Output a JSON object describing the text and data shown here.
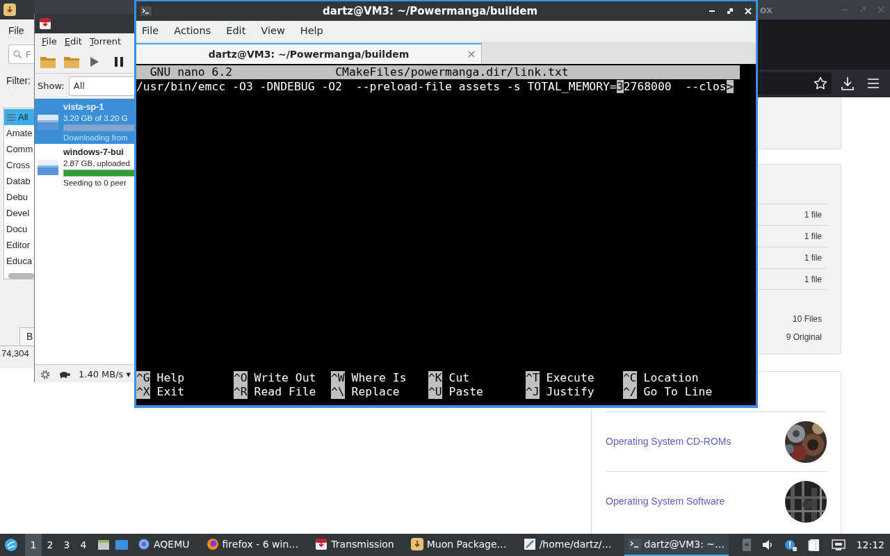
{
  "firefox": {
    "title": "ox",
    "file_counts": [
      "1 file",
      "1 file",
      "1 file",
      "1 file"
    ],
    "totals": [
      "10 Files",
      "9 Original"
    ],
    "links": [
      {
        "text": "Operating System CD-ROMs"
      },
      {
        "text": "Operating System Software"
      }
    ]
  },
  "muon": {
    "menu": [
      "File"
    ],
    "search": {
      "placeholder": "F"
    },
    "filter_label": "Filter:",
    "categories": [
      {
        "label": "All",
        "selected": true
      },
      {
        "label": "Amate",
        "selected": false
      },
      {
        "label": "Comm",
        "selected": false
      },
      {
        "label": "Cross",
        "selected": false
      },
      {
        "label": "Datab",
        "selected": false
      },
      {
        "label": "Debu",
        "selected": false
      },
      {
        "label": "Devel",
        "selected": false
      },
      {
        "label": "Docu",
        "selected": false
      },
      {
        "label": "Editor",
        "selected": false
      },
      {
        "label": "Educa",
        "selected": false
      }
    ],
    "bottom_tab": "B",
    "status": "74,304"
  },
  "transmission": {
    "menu": [
      "File",
      "Edit",
      "Torrent"
    ],
    "show_label": "Show:",
    "show_value": "All",
    "torrents": [
      {
        "name": "vista-sp-1",
        "size": "3.20 GB of 3.20 G",
        "level": 1,
        "status": "Downloading from",
        "kind": "downloading",
        "selected": true
      },
      {
        "name": "windows-7-bui",
        "size": "2.87 GB, uploaded",
        "level": 1,
        "status": "Seeding to 0 peer",
        "kind": "seeding",
        "selected": false
      }
    ],
    "speed": "1.40 MB/s ▾"
  },
  "terminal": {
    "title": "dartz@VM3: ~/Powermanga/buildem",
    "menu": [
      "File",
      "Actions",
      "Edit",
      "View",
      "Help"
    ],
    "tab": "dartz@VM3: ~/Powermanga/buildem",
    "nano": {
      "version": "GNU nano 6.2",
      "filename": "CMakeFiles/powermanga.dir/link.txt",
      "line_before_cursor": "/usr/bin/emcc -O3 -DNDEBUG -O2  --preload-file assets -s TOTAL_MEMORY=",
      "cursor_char": "3",
      "line_after_cursor": "2768000  --clos",
      "overflow_mark": ">",
      "shortcuts": [
        [
          {
            "key": "^G",
            "label": "Help"
          },
          {
            "key": "^O",
            "label": "Write Out"
          },
          {
            "key": "^W",
            "label": "Where Is"
          },
          {
            "key": "^K",
            "label": "Cut"
          },
          {
            "key": "^T",
            "label": "Execute"
          },
          {
            "key": "^C",
            "label": "Location"
          }
        ],
        [
          {
            "key": "^X",
            "label": "Exit"
          },
          {
            "key": "^R",
            "label": "Read File"
          },
          {
            "key": "^\\",
            "label": "Replace"
          },
          {
            "key": "^U",
            "label": "Paste"
          },
          {
            "key": "^J",
            "label": "Justify"
          },
          {
            "key": "^/",
            "label": "Go To Line"
          }
        ]
      ]
    }
  },
  "taskbar": {
    "workspaces": [
      {
        "label": "1",
        "selected": true
      },
      {
        "label": "2",
        "selected": false
      },
      {
        "label": "3",
        "selected": false
      },
      {
        "label": "4",
        "selected": false
      }
    ],
    "tasks": [
      {
        "label": "AQEMU",
        "kind": "emulator",
        "selected": false
      },
      {
        "label": "firefox - 6 win…",
        "kind": "browser",
        "selected": false
      },
      {
        "label": "Transmission",
        "kind": "torrent",
        "selected": false
      },
      {
        "label": "Muon Package…",
        "kind": "package",
        "selected": false
      },
      {
        "label": "/home/dartz/…",
        "kind": "editor",
        "selected": false
      },
      {
        "label": "dartz@VM3: ~…",
        "kind": "terminal",
        "selected": true
      }
    ],
    "clock": "12:12"
  }
}
